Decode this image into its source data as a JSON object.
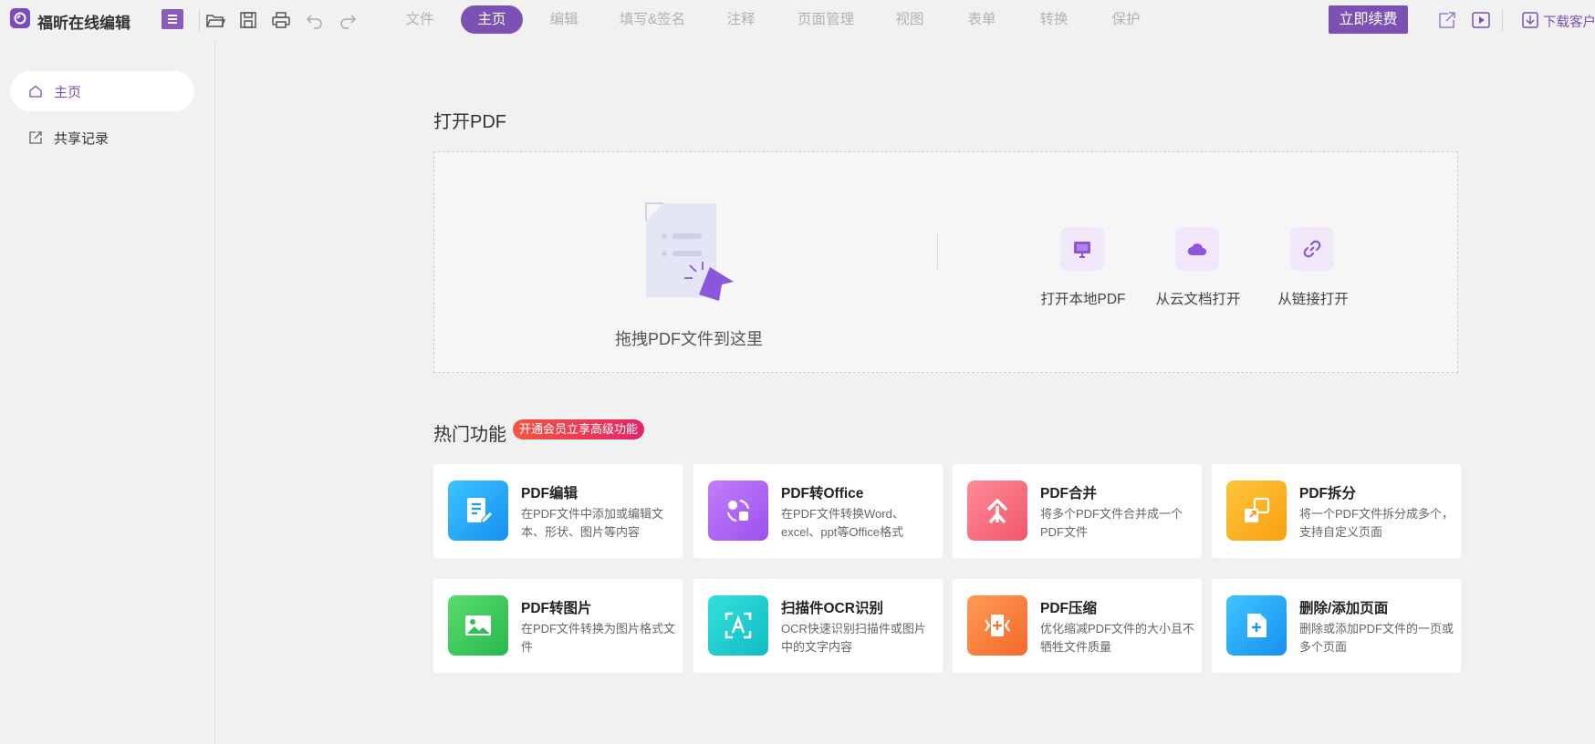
{
  "header": {
    "app_title": "福昕在线编辑",
    "nav_tabs": [
      {
        "label": "文件"
      },
      {
        "label": "主页",
        "active": true
      },
      {
        "label": "编辑"
      },
      {
        "label": "填写&签名"
      },
      {
        "label": "注释"
      },
      {
        "label": "页面管理"
      },
      {
        "label": "视图"
      },
      {
        "label": "表单"
      },
      {
        "label": "转换"
      },
      {
        "label": "保护"
      }
    ],
    "renew_label": "立即续费",
    "download_label": "下载客户"
  },
  "sidebar": {
    "items": [
      {
        "label": "主页",
        "icon": "home-icon",
        "active": true
      },
      {
        "label": "共享记录",
        "icon": "share-icon"
      }
    ]
  },
  "open_pdf": {
    "title": "打开PDF",
    "drop_text": "拖拽PDF文件到这里",
    "options": [
      {
        "label": "打开本地PDF",
        "icon": "monitor-icon"
      },
      {
        "label": "从云文档打开",
        "icon": "cloud-icon"
      },
      {
        "label": "从链接打开",
        "icon": "link-icon"
      }
    ]
  },
  "hot_features": {
    "title": "热门功能",
    "badge": "开通会员立享高级功能",
    "cards": [
      {
        "title": "PDF编辑",
        "desc": "在PDF文件中添加或编辑文本、形状、图片等内容",
        "icon": "edit-doc-icon",
        "color": "#1aa0f5"
      },
      {
        "title": "PDF转Office",
        "desc": "在PDF文件转换Word、excel、ppt等Office格式",
        "icon": "convert-icon",
        "color": "#a665f0"
      },
      {
        "title": "PDF合并",
        "desc": "将多个PDF文件合并成一个PDF文件",
        "icon": "merge-icon",
        "color": "#f8687a"
      },
      {
        "title": "PDF拆分",
        "desc": "将一个PDF文件拆分成多个， 支持自定义页面",
        "icon": "split-icon",
        "color": "#fbb120"
      },
      {
        "title": "PDF转图片",
        "desc": "在PDF文件转换为图片格式文件",
        "icon": "image-icon",
        "color": "#38c95a"
      },
      {
        "title": "扫描件OCR识别",
        "desc": "OCR快速识别扫描件或图片中的文字内容",
        "icon": "ocr-icon",
        "color": "#1fcdd0"
      },
      {
        "title": "PDF压缩",
        "desc": "优化缩减PDF文件的大小且不牺牲文件质量",
        "icon": "compress-icon",
        "color": "#fa7a3c"
      },
      {
        "title": "删除/添加页面",
        "desc": "删除或添加PDF文件的一页或多个页面",
        "icon": "add-page-icon",
        "color": "#1aa5f5"
      }
    ]
  }
}
